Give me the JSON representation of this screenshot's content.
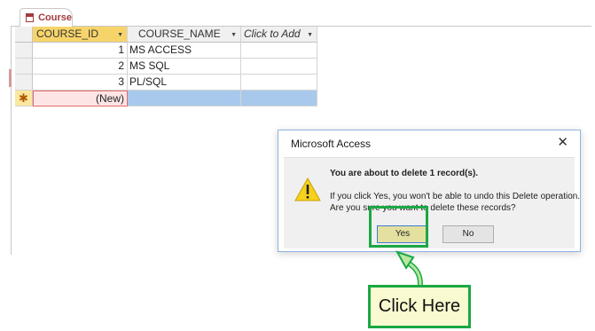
{
  "tab": {
    "label": "Course"
  },
  "table": {
    "columns": [
      "COURSE_ID",
      "COURSE_NAME",
      "Click to Add"
    ],
    "rows": [
      {
        "id": "1",
        "name": "MS ACCESS"
      },
      {
        "id": "2",
        "name": "MS SQL"
      },
      {
        "id": "3",
        "name": "PL/SQL"
      }
    ],
    "new_row": {
      "marker": "✱",
      "id": "(New)"
    }
  },
  "dialog": {
    "title": "Microsoft Access",
    "close": "✕",
    "heading": "You are about to delete 1 record(s).",
    "line1": "If you click Yes, you won't be able to undo this Delete operation.",
    "line2": "Are you sure you want to delete these records?",
    "yes_label": "Yes",
    "no_label": "No"
  },
  "callout": {
    "label": "Click Here"
  },
  "colors": {
    "highlight": "#1aa844",
    "header_selected": "#f7d46a",
    "new_row": "#a9c9ec"
  }
}
